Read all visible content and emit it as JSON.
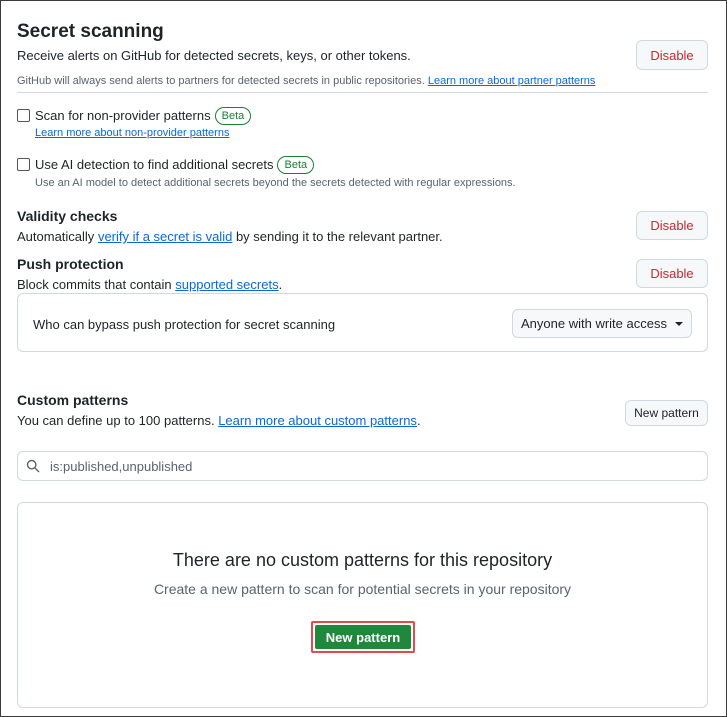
{
  "secret_scanning": {
    "title": "Secret scanning",
    "description": "Receive alerts on GitHub for detected secrets, keys, or other tokens.",
    "disable_label": "Disable",
    "partner_note": "GitHub will always send alerts to partners for detected secrets in public repositories.",
    "partner_link": "Learn more about partner patterns"
  },
  "non_provider": {
    "label": "Scan for non-provider patterns",
    "badge": "Beta",
    "link": "Learn more about non-provider patterns",
    "checked": false
  },
  "ai_detection": {
    "label": "Use AI detection to find additional secrets",
    "badge": "Beta",
    "description": "Use an AI model to detect additional secrets beyond the secrets detected with regular expressions.",
    "checked": false
  },
  "validity": {
    "title": "Validity checks",
    "desc_before": "Automatically",
    "link": "verify if a secret is valid",
    "desc_after": "by sending it to the relevant partner.",
    "disable_label": "Disable"
  },
  "push_protection": {
    "title": "Push protection",
    "desc_before": "Block commits that contain",
    "link": "supported secrets",
    "desc_after": ".",
    "disable_label": "Disable",
    "bypass_label": "Who can bypass push protection for secret scanning",
    "bypass_value": "Anyone with write access"
  },
  "custom_patterns": {
    "title": "Custom patterns",
    "desc": "You can define up to 100 patterns.",
    "link": "Learn more about custom patterns",
    "desc_after": ".",
    "new_button": "New pattern",
    "search_value": "is:published,unpublished",
    "empty_title": "There are no custom patterns for this repository",
    "empty_desc": "Create a new pattern to scan for potential secrets in your repository",
    "primary_button": "New pattern"
  },
  "colors": {
    "danger": "#d1242f",
    "link": "#0969da",
    "success": "#1a7f37",
    "primary_button": "#1f883d",
    "highlight": "#e04b4b"
  }
}
